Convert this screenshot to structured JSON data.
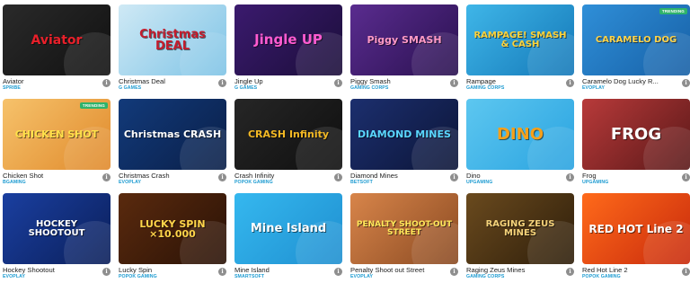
{
  "games": [
    {
      "title": "Aviator",
      "provider": "SPRIBE",
      "art": "Aviator",
      "bg": "linear-gradient(135deg,#2a2a2a,#111)",
      "art_color": "#e8202a",
      "art_size": "14px",
      "badge": ""
    },
    {
      "title": "Christmas Deal",
      "provider": "G GAMES",
      "art": "Christmas DEAL",
      "bg": "linear-gradient(135deg,#cfe9f5,#7fc4e6)",
      "art_color": "#c41d2d",
      "art_size": "13px",
      "badge": ""
    },
    {
      "title": "Jingle Up",
      "provider": "G GAMES",
      "art": "Jingle UP",
      "bg": "linear-gradient(135deg,#3b1a6e,#1b0e3a)",
      "art_color": "#ff5bd1",
      "art_size": "15px",
      "badge": ""
    },
    {
      "title": "Piggy Smash",
      "provider": "GAMING CORPS",
      "art": "Piggy SMASH",
      "bg": "linear-gradient(135deg,#5a2c8f,#2a1150)",
      "art_color": "#ff9ac6",
      "art_size": "11px",
      "badge": ""
    },
    {
      "title": "Rampage",
      "provider": "GAMING CORPS",
      "art": "RAMPAGE! SMASH & CASH",
      "bg": "linear-gradient(135deg,#3fb6e8,#1478b8)",
      "art_color": "#ffd33a",
      "art_size": "10px",
      "badge": ""
    },
    {
      "title": "Caramelo Dog Lucky R...",
      "provider": "EVOPLAY",
      "art": "CARAMELO DOG",
      "bg": "linear-gradient(135deg,#2f8fd8,#1760a6)",
      "art_color": "#ffd44a",
      "art_size": "10px",
      "badge": "TRENDING"
    },
    {
      "title": "Chicken Shot",
      "provider": "BGAMING",
      "art": "CHICKEN SHOT",
      "bg": "linear-gradient(135deg,#f6c26b,#e08a2c)",
      "art_color": "#ffe14a",
      "art_size": "11px",
      "badge": "TRENDING"
    },
    {
      "title": "Christmas Crash",
      "provider": "EVOPLAY",
      "art": "Christmas CRASH",
      "bg": "linear-gradient(135deg,#123a7a,#0a1f48)",
      "art_color": "#ffffff",
      "art_size": "11px",
      "badge": ""
    },
    {
      "title": "Crash Infinity",
      "provider": "POPOK GAMING",
      "art": "CRASH Infinity",
      "bg": "linear-gradient(135deg,#262626,#0f0f0f)",
      "art_color": "#f2b824",
      "art_size": "11px",
      "badge": ""
    },
    {
      "title": "Diamond Mines",
      "provider": "BETSOFT",
      "art": "DIAMOND MINES",
      "bg": "linear-gradient(135deg,#1c2f6e,#0c1538)",
      "art_color": "#5ad7ff",
      "art_size": "11px",
      "badge": ""
    },
    {
      "title": "Dino",
      "provider": "UPGAMING",
      "art": "DINO",
      "bg": "linear-gradient(135deg,#5dc7f0,#2aa3e0)",
      "art_color": "#f6a01a",
      "art_size": "18px",
      "badge": ""
    },
    {
      "title": "Frog",
      "provider": "UPGAMING",
      "art": "FROG",
      "bg": "linear-gradient(135deg,#b83a3a,#5a1818)",
      "art_color": "#ffffff",
      "art_size": "18px",
      "badge": ""
    },
    {
      "title": "Hockey Shootout",
      "provider": "EVOPLAY",
      "art": "HOCKEY SHOOTOUT",
      "bg": "linear-gradient(135deg,#1a3fa0,#0b1f5a)",
      "art_color": "#ffffff",
      "art_size": "10px",
      "badge": ""
    },
    {
      "title": "Lucky Spin",
      "provider": "POPOK GAMING",
      "art": "LUCKY SPIN ×10.000",
      "bg": "linear-gradient(135deg,#5a2a0e,#2a1206)",
      "art_color": "#ffd54a",
      "art_size": "11px",
      "badge": ""
    },
    {
      "title": "Mine Island",
      "provider": "SMARTSOFT",
      "art": "Mine Island",
      "bg": "linear-gradient(135deg,#35b8ef,#1f8fd0)",
      "art_color": "#ffffff",
      "art_size": "13px",
      "badge": ""
    },
    {
      "title": "Penalty Shoot out Street",
      "provider": "EVOPLAY",
      "art": "PENALTY SHOOT-OUT STREET",
      "bg": "linear-gradient(135deg,#d8854a,#8a4a22)",
      "art_color": "#ffe75a",
      "art_size": "9px",
      "badge": ""
    },
    {
      "title": "Raging Zeus Mines",
      "provider": "GAMING CORPS",
      "art": "RAGING ZEUS MINES",
      "bg": "linear-gradient(135deg,#6a4a1e,#2e1e0a)",
      "art_color": "#f4d27a",
      "art_size": "10px",
      "badge": ""
    },
    {
      "title": "Red Hot Line 2",
      "provider": "POPOK GAMING",
      "art": "RED HOT Line 2",
      "bg": "linear-gradient(135deg,#ff6a1a,#c82a0c)",
      "art_color": "#ffffff",
      "art_size": "12px",
      "badge": ""
    }
  ],
  "info_glyph": "i"
}
